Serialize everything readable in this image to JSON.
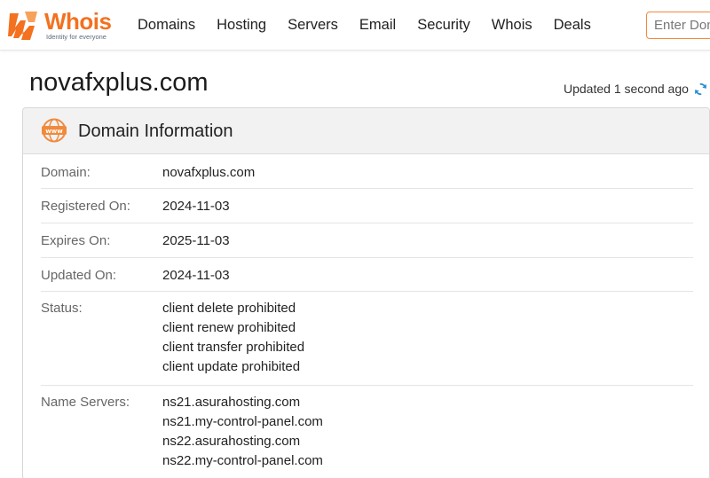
{
  "header": {
    "logo_name": "Whois",
    "logo_tagline": "Identity for everyone",
    "nav": [
      "Domains",
      "Hosting",
      "Servers",
      "Email",
      "Security",
      "Whois",
      "Deals"
    ],
    "search_placeholder": "Enter Domain"
  },
  "page": {
    "domain_title": "novafxplus.com",
    "updated_text": "Updated 1 second ago"
  },
  "card": {
    "title": "Domain Information",
    "rows": [
      {
        "label": "Domain:",
        "values": [
          "novafxplus.com"
        ]
      },
      {
        "label": "Registered On:",
        "values": [
          "2024-11-03"
        ]
      },
      {
        "label": "Expires On:",
        "values": [
          "2025-11-03"
        ]
      },
      {
        "label": "Updated On:",
        "values": [
          "2024-11-03"
        ]
      },
      {
        "label": "Status:",
        "values": [
          "client delete prohibited",
          "client renew prohibited",
          "client transfer prohibited",
          "client update prohibited"
        ]
      },
      {
        "label": "Name Servers:",
        "values": [
          "ns21.asurahosting.com",
          "ns21.my-control-panel.com",
          "ns22.asurahosting.com",
          "ns22.my-control-panel.com"
        ]
      }
    ]
  },
  "colors": {
    "brand": "#f3711f",
    "refresh": "#2a8fd6"
  },
  "icons": {
    "logo": "whois-logo-icon",
    "www": "www-globe-icon",
    "refresh": "refresh-icon"
  }
}
